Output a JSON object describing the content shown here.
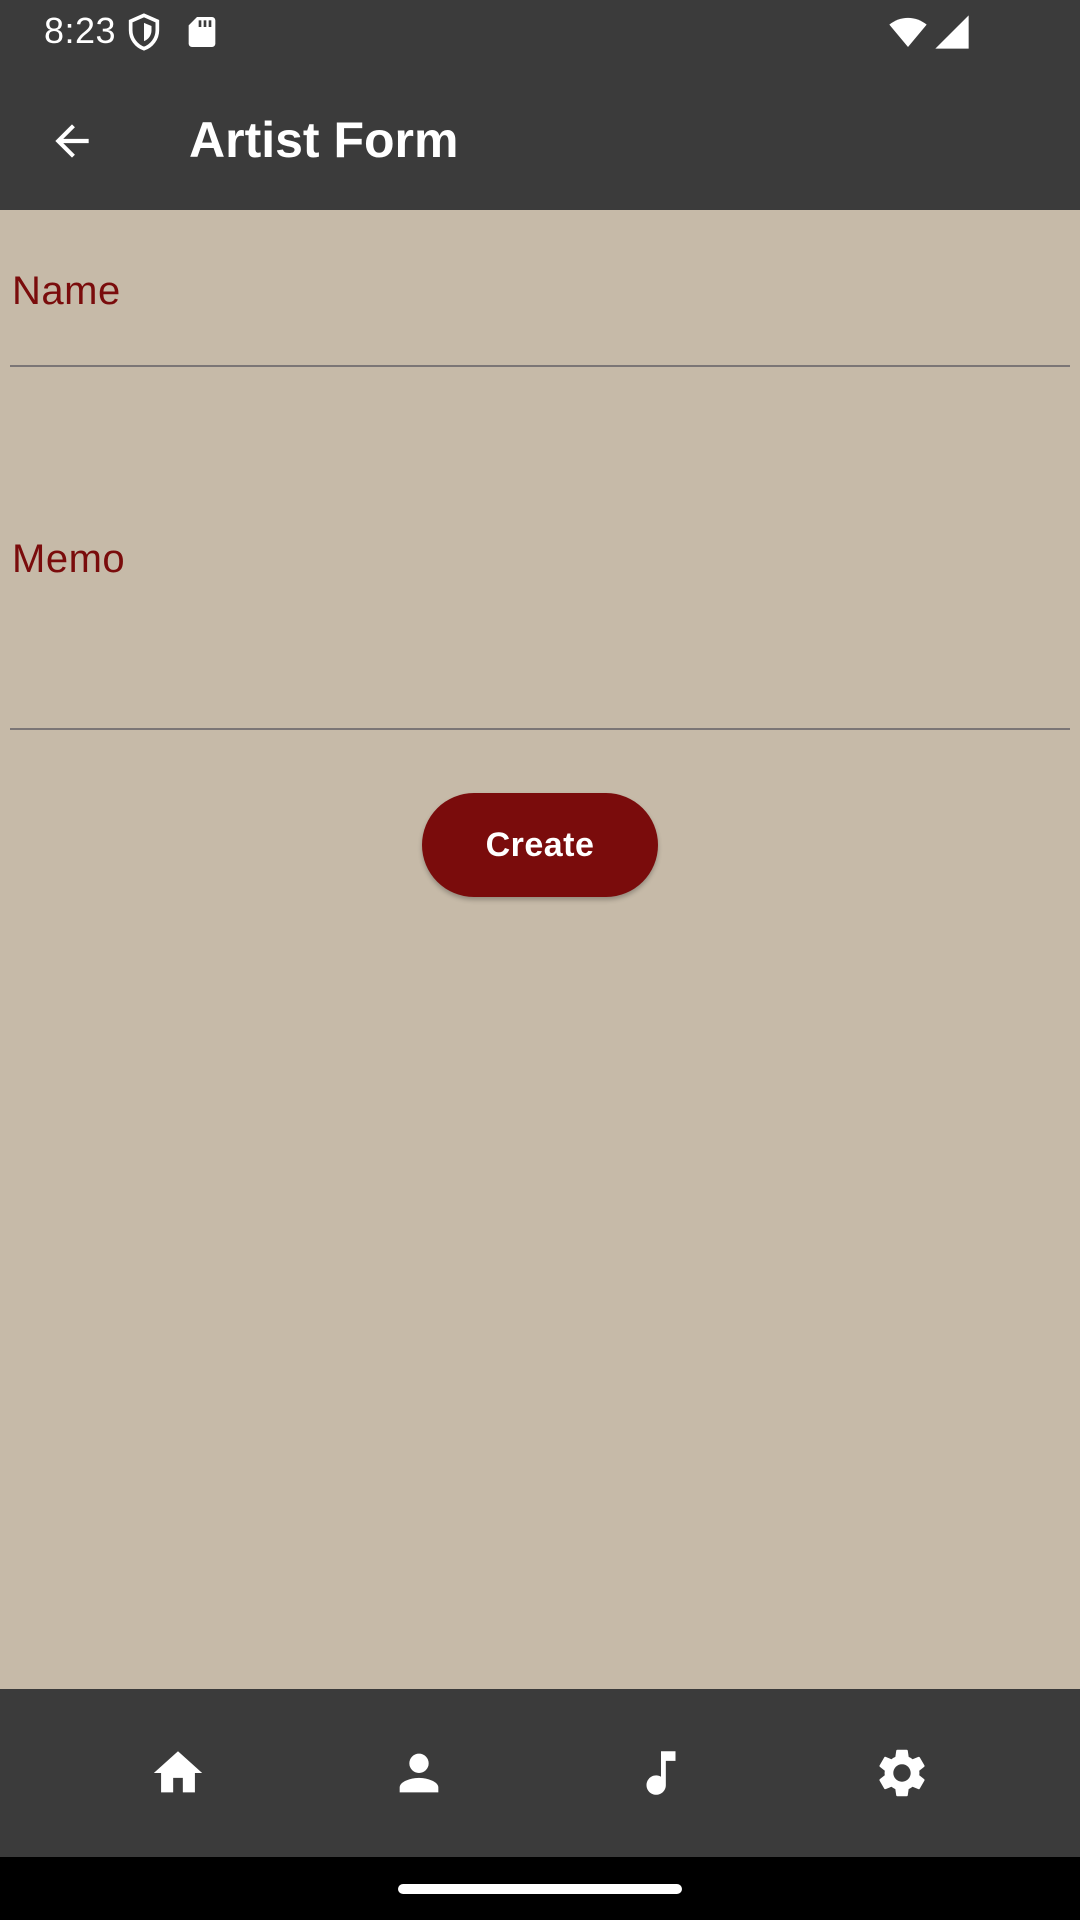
{
  "status_bar": {
    "time": "8:23",
    "left_icons": [
      "shield-icon",
      "sd-card-icon"
    ],
    "right_icons": [
      "wifi-icon",
      "cellular-signal-icon"
    ]
  },
  "app_bar": {
    "back_icon": "arrow-back-icon",
    "title": "Artist Form"
  },
  "form": {
    "name": {
      "label": "Name",
      "value": ""
    },
    "memo": {
      "label": "Memo",
      "value": ""
    },
    "create_label": "Create"
  },
  "bottom_nav": {
    "items": [
      {
        "icon": "home-icon"
      },
      {
        "icon": "person-icon"
      },
      {
        "icon": "music-note-icon"
      },
      {
        "icon": "settings-icon"
      }
    ]
  },
  "colors": {
    "bar_background": "#3b3b3b",
    "page_background": "#c6baa8",
    "accent": "#7a0c0c",
    "underline": "#7b7676"
  }
}
